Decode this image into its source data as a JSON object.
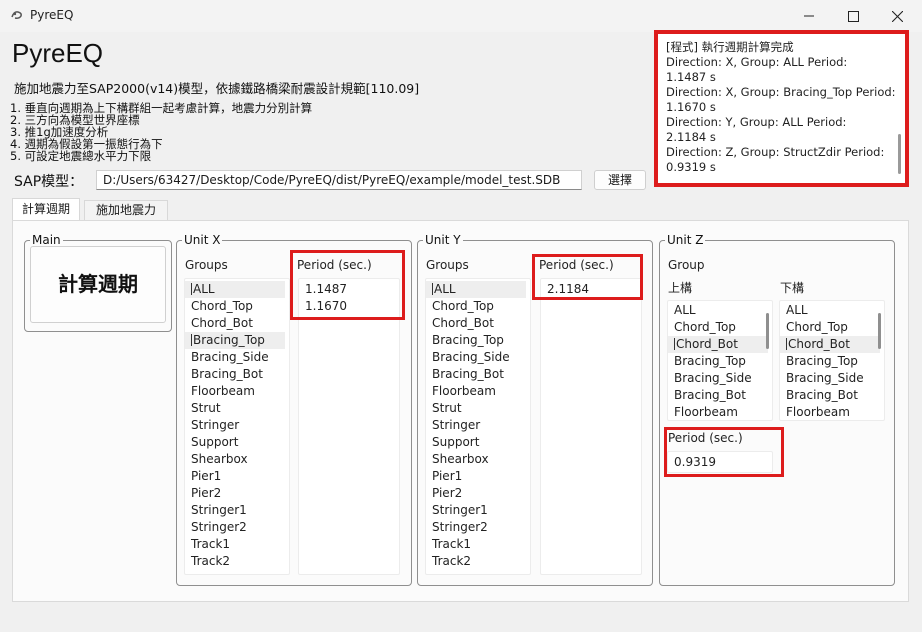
{
  "window": {
    "title": "PyreEQ"
  },
  "app": {
    "title": "PyreEQ",
    "subtitle": "施加地震力至SAP2000(v14)模型，依據鐵路橋梁耐震設計規範[110.09]",
    "notes": [
      "1.  垂直向週期為上下構群組一起考慮計算，地震力分別計算",
      "2.  三方向為模型世界座標",
      "3.  推1g加速度分析",
      "4.  週期為假設第一振態行為下",
      "5.  可設定地震總水平力下限"
    ]
  },
  "sap": {
    "label": "SAP模型：",
    "path": "D:/Users/63427/Desktop/Code/PyreEQ/dist/PyreEQ/example/model_test.SDB",
    "select_label": "選擇"
  },
  "log": {
    "lines": [
      "[程式] 執行週期計算完成",
      "Direction: X, Group: ALL       Period:",
      "1.1487 s",
      "Direction: X, Group: Bracing_Top Period:",
      "1.1670 s",
      "Direction: Y, Group: ALL       Period:",
      "2.1184 s",
      "Direction: Z, Group: StructZdir Period:",
      "0.9319 s"
    ]
  },
  "tabs": [
    {
      "label": "計算週期",
      "active": true
    },
    {
      "label": "施加地震力",
      "active": false
    }
  ],
  "main": {
    "title": "Main",
    "calc_label": "計算週期"
  },
  "unit_x": {
    "title": "Unit X",
    "groups_label": "Groups",
    "period_label": "Period (sec.)",
    "groups": [
      "ALL",
      "Chord_Top",
      "Chord_Bot",
      "Bracing_Top",
      "Bracing_Side",
      "Bracing_Bot",
      "Floorbeam",
      "Strut",
      "Stringer",
      "Support",
      "Shearbox",
      "Pier1",
      "Pier2",
      "Stringer1",
      "Stringer2",
      "Track1",
      "Track2"
    ],
    "periods": [
      "1.1487",
      "1.1670"
    ]
  },
  "unit_y": {
    "title": "Unit Y",
    "groups_label": "Groups",
    "period_label": "Period (sec.)",
    "groups": [
      "ALL",
      "Chord_Top",
      "Chord_Bot",
      "Bracing_Top",
      "Bracing_Side",
      "Bracing_Bot",
      "Floorbeam",
      "Strut",
      "Stringer",
      "Support",
      "Shearbox",
      "Pier1",
      "Pier2",
      "Stringer1",
      "Stringer2",
      "Track1",
      "Track2"
    ],
    "periods": [
      "2.1184"
    ]
  },
  "unit_z": {
    "title": "Unit Z",
    "group_label": "Group",
    "upper_label": "上構",
    "lower_label": "下構",
    "upper_groups": [
      "ALL",
      "Chord_Top",
      "Chord_Bot",
      "Bracing_Top",
      "Bracing_Side",
      "Bracing_Bot",
      "Floorbeam"
    ],
    "lower_groups": [
      "ALL",
      "Chord_Top",
      "Chord_Bot",
      "Bracing_Top",
      "Bracing_Side",
      "Bracing_Bot",
      "Floorbeam"
    ],
    "period_label": "Period (sec.)",
    "period_value": "0.9319"
  },
  "colors": {
    "highlight": "#dd1c1c",
    "window_bg": "#f0f0f0"
  }
}
